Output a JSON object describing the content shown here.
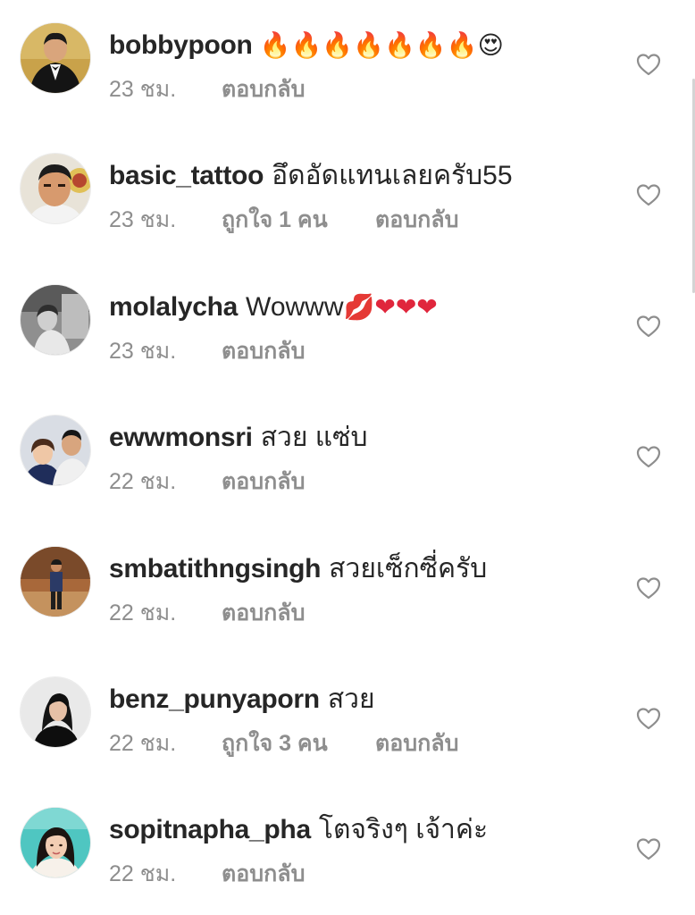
{
  "colors": {
    "username": "#262626",
    "meta": "#8e8e8e",
    "heart_outline": "#8e8e8e"
  },
  "comments": [
    {
      "username": "bobbypoon",
      "text": "",
      "emoji": "🔥🔥🔥🔥🔥🔥🔥😍",
      "time": "23 ชม.",
      "likes": "",
      "reply": "ตอบกลับ",
      "avatar": "avatar-man-tuxedo"
    },
    {
      "username": "basic_tattoo",
      "text": "อึดอัดแทนเลยครับ55",
      "emoji": "",
      "time": "23 ชม.",
      "likes": "ถูกใจ 1 คน",
      "reply": "ตอบกลับ",
      "avatar": "avatar-man-face"
    },
    {
      "username": "molalycha",
      "text": "Wowww",
      "emoji": "💋❤❤❤",
      "time": "23 ชม.",
      "likes": "",
      "reply": "ตอบกลับ",
      "avatar": "avatar-grayscale-photo"
    },
    {
      "username": "ewwmonsri",
      "text": "สวย แซ่บ",
      "emoji": "",
      "time": "22 ชม.",
      "likes": "",
      "reply": "ตอบกลับ",
      "avatar": "avatar-couple"
    },
    {
      "username": "smbatithngsingh",
      "text": "สวยเซ็กซี่ครับ",
      "emoji": "",
      "time": "22 ชม.",
      "likes": "",
      "reply": "ตอบกลับ",
      "avatar": "avatar-standing-person"
    },
    {
      "username": "benz_punyaporn",
      "text": "สวย",
      "emoji": "",
      "time": "22 ชม.",
      "likes": "ถูกใจ 3 คน",
      "reply": "ตอบกลับ",
      "avatar": "avatar-woman-dark"
    },
    {
      "username": "sopitnapha_pha",
      "text": "โตจริงๆ เจ้าค่ะ",
      "emoji": "",
      "time": "22 ชม.",
      "likes": "",
      "reply": "ตอบกลับ",
      "avatar": "avatar-woman-teal"
    }
  ]
}
